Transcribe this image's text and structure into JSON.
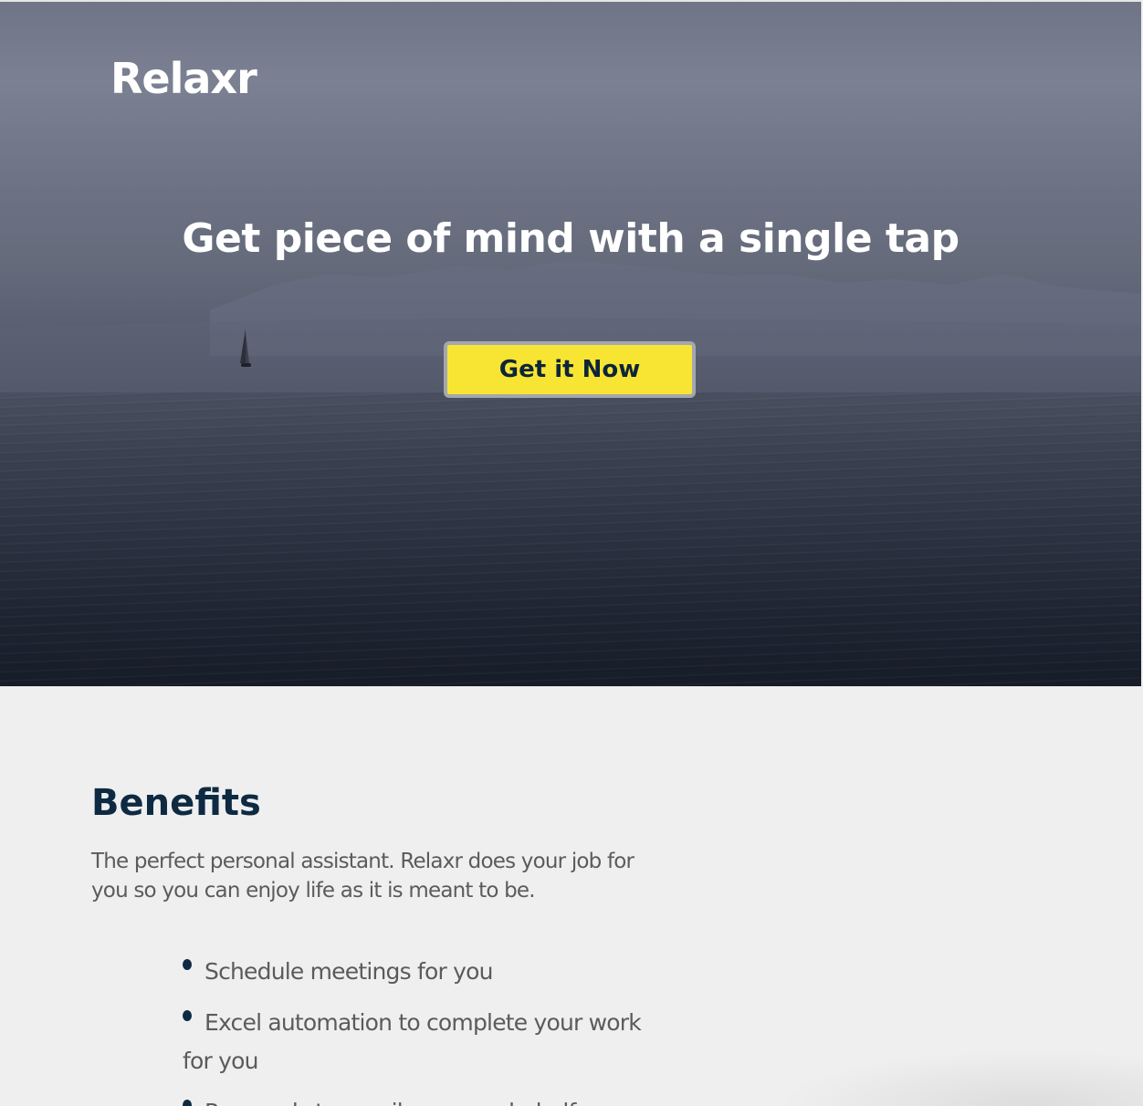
{
  "brand": {
    "logo": "Relaxr"
  },
  "hero": {
    "headline": "Get piece of mind with a single tap",
    "cta_label": "Get it Now"
  },
  "benefits": {
    "title": "Benefits",
    "description": "The perfect personal assistant. Relaxr does your job for you so you can enjoy life as it is meant to be.",
    "items": [
      "Schedule meetings for you",
      "Excel automation to complete your work for you",
      "Responds to emails on your behalf"
    ]
  },
  "colors": {
    "cta_background": "#f8e533",
    "cta_text": "#0d2539",
    "heading": "#0e2a42",
    "body_text": "#5b5b5b",
    "page_background": "#efefef"
  }
}
